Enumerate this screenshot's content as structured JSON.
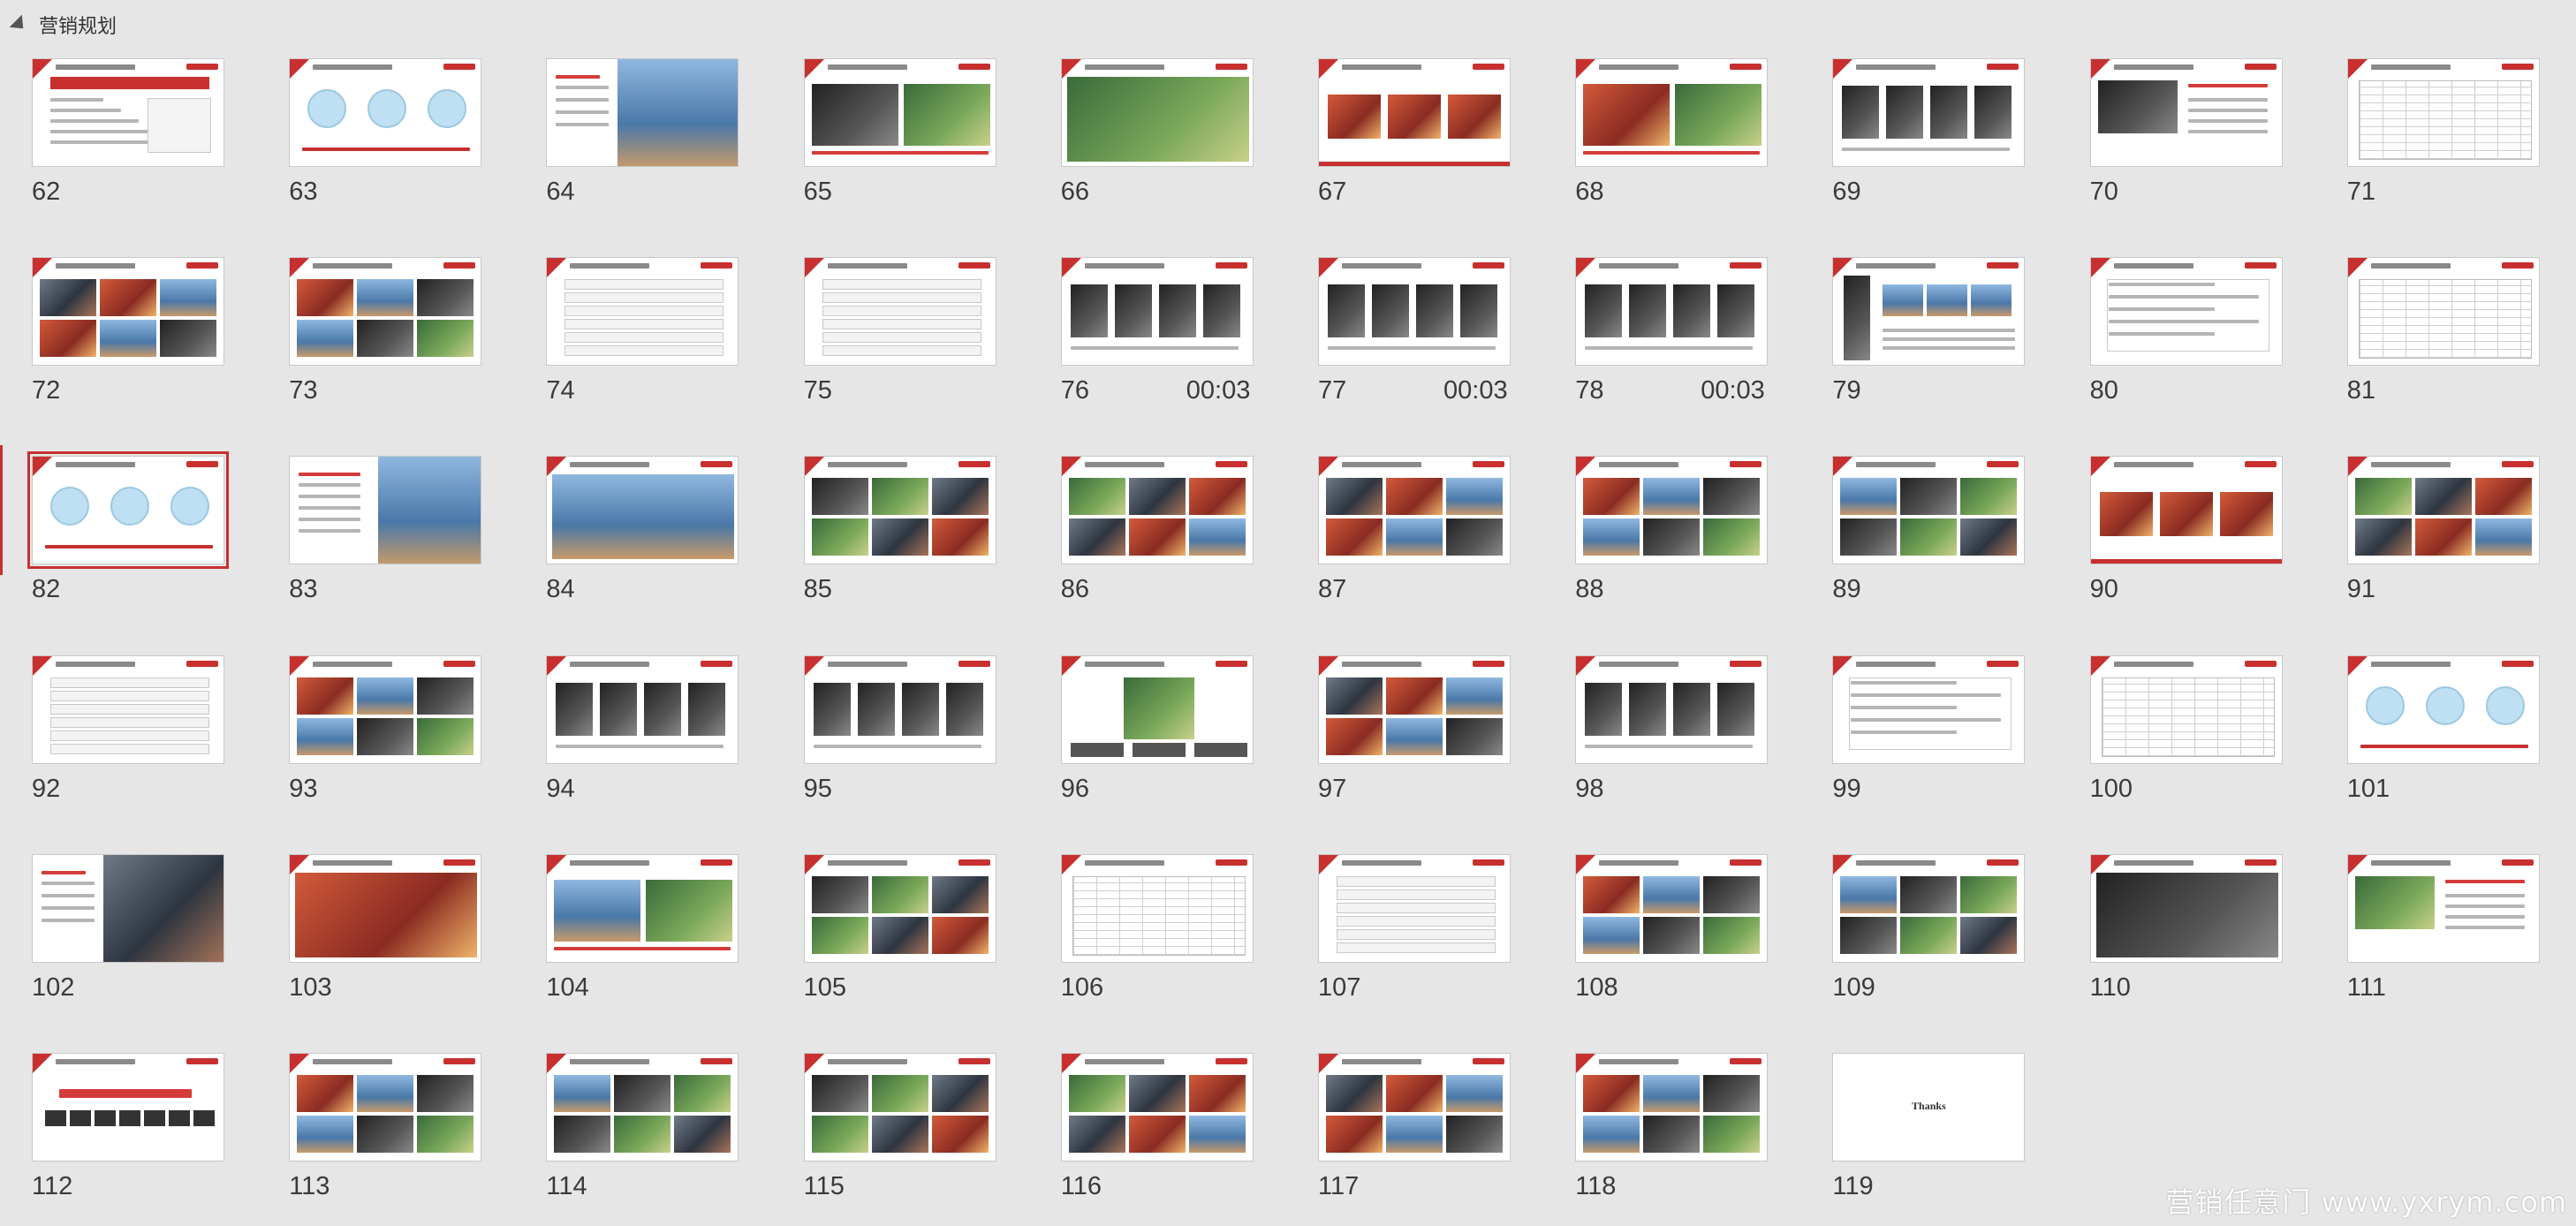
{
  "section": {
    "title": "营销规划"
  },
  "slides": [
    {
      "num": "62",
      "kind": "diagram"
    },
    {
      "num": "63",
      "kind": "circles"
    },
    {
      "num": "64",
      "kind": "car-split"
    },
    {
      "num": "65",
      "kind": "two-photo"
    },
    {
      "num": "66",
      "kind": "banner"
    },
    {
      "num": "67",
      "kind": "product"
    },
    {
      "num": "68",
      "kind": "two-photo"
    },
    {
      "num": "69",
      "kind": "screens"
    },
    {
      "num": "70",
      "kind": "text-photo"
    },
    {
      "num": "71",
      "kind": "table"
    },
    {
      "num": "72",
      "kind": "photo-grid"
    },
    {
      "num": "73",
      "kind": "photo-grid"
    },
    {
      "num": "74",
      "kind": "list"
    },
    {
      "num": "75",
      "kind": "list"
    },
    {
      "num": "76",
      "kind": "screens",
      "timing": "00:03"
    },
    {
      "num": "77",
      "kind": "screens",
      "timing": "00:03"
    },
    {
      "num": "78",
      "kind": "screens",
      "timing": "00:03"
    },
    {
      "num": "79",
      "kind": "person"
    },
    {
      "num": "80",
      "kind": "text"
    },
    {
      "num": "81",
      "kind": "table"
    },
    {
      "num": "82",
      "kind": "circles",
      "selected": true
    },
    {
      "num": "83",
      "kind": "road"
    },
    {
      "num": "84",
      "kind": "banner"
    },
    {
      "num": "85",
      "kind": "photo-grid"
    },
    {
      "num": "86",
      "kind": "photo-grid"
    },
    {
      "num": "87",
      "kind": "photo-grid"
    },
    {
      "num": "88",
      "kind": "photo-grid"
    },
    {
      "num": "89",
      "kind": "photo-grid"
    },
    {
      "num": "90",
      "kind": "product"
    },
    {
      "num": "91",
      "kind": "photo-grid"
    },
    {
      "num": "92",
      "kind": "list"
    },
    {
      "num": "93",
      "kind": "photo-grid"
    },
    {
      "num": "94",
      "kind": "screens"
    },
    {
      "num": "95",
      "kind": "screens"
    },
    {
      "num": "96",
      "kind": "map"
    },
    {
      "num": "97",
      "kind": "photo-grid"
    },
    {
      "num": "98",
      "kind": "screens"
    },
    {
      "num": "99",
      "kind": "text"
    },
    {
      "num": "100",
      "kind": "table"
    },
    {
      "num": "101",
      "kind": "circles"
    },
    {
      "num": "102",
      "kind": "car-split"
    },
    {
      "num": "103",
      "kind": "banner"
    },
    {
      "num": "104",
      "kind": "two-photo"
    },
    {
      "num": "105",
      "kind": "photo-grid"
    },
    {
      "num": "106",
      "kind": "table"
    },
    {
      "num": "107",
      "kind": "list"
    },
    {
      "num": "108",
      "kind": "photo-grid"
    },
    {
      "num": "109",
      "kind": "photo-grid"
    },
    {
      "num": "110",
      "kind": "banner"
    },
    {
      "num": "111",
      "kind": "text-photo"
    },
    {
      "num": "112",
      "kind": "title-slide"
    },
    {
      "num": "113",
      "kind": "photo-grid"
    },
    {
      "num": "114",
      "kind": "photo-grid"
    },
    {
      "num": "115",
      "kind": "photo-grid"
    },
    {
      "num": "116",
      "kind": "photo-grid"
    },
    {
      "num": "117",
      "kind": "photo-grid"
    },
    {
      "num": "118",
      "kind": "photo-grid"
    },
    {
      "num": "119",
      "kind": "thanks",
      "text": "Thanks"
    }
  ],
  "watermark": "营销任意门  www.yxrym.com",
  "colors": {
    "accent": "#c7302f",
    "background": "#e6e6e6"
  }
}
